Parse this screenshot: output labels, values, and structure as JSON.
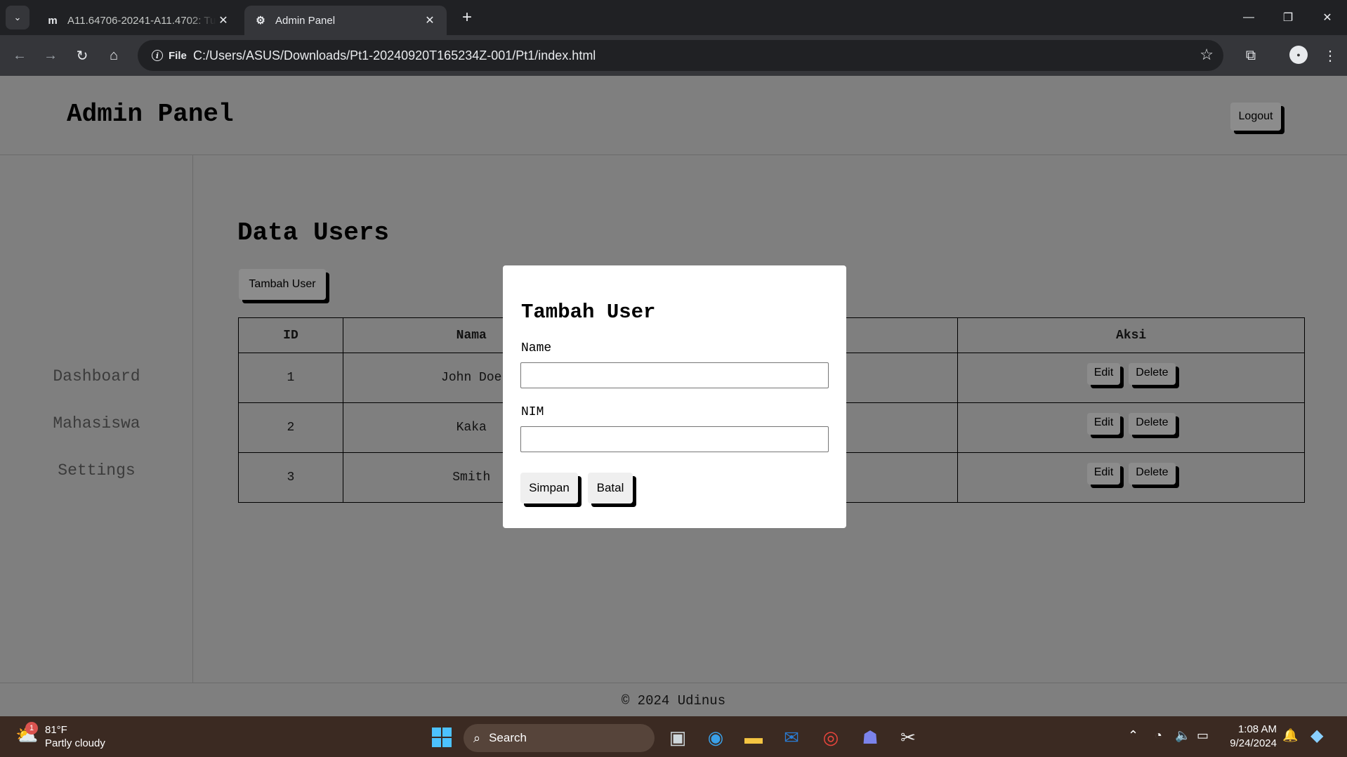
{
  "browser": {
    "tabs": [
      {
        "label": "A11.64706-20241-A11.4702: Tu",
        "favicon": "m",
        "active": false
      },
      {
        "label": "Admin Panel",
        "favicon": "gear-link-icon",
        "active": true
      }
    ],
    "site_chip": "File",
    "url": "C:/Users/ASUS/Downloads/Pt1-20240920T165234Z-001/Pt1/index.html"
  },
  "header": {
    "brand": "Admin Panel",
    "logout_label": "Logout"
  },
  "sidebar": {
    "items": [
      {
        "label": "Dashboard"
      },
      {
        "label": "Mahasiswa"
      },
      {
        "label": "Settings"
      }
    ]
  },
  "main": {
    "title": "Data Users",
    "add_label": "Tambah User",
    "table": {
      "headers": [
        "ID",
        "Nama",
        "Aksi"
      ],
      "rows": [
        {
          "id": "1",
          "nama": "John Doe"
        },
        {
          "id": "2",
          "nama": "Kaka"
        },
        {
          "id": "3",
          "nama": "Smith"
        }
      ],
      "edit_label": "Edit",
      "delete_label": "Delete"
    }
  },
  "footer": {
    "text": "© 2024 Udinus"
  },
  "modal": {
    "title": "Tambah User",
    "name_label": "Name",
    "name_value": "",
    "nim_label": "NIM",
    "nim_value": "",
    "save_label": "Simpan",
    "cancel_label": "Batal"
  },
  "taskbar": {
    "weather_temp": "81°F",
    "weather_desc": "Partly cloudy",
    "weather_badge": "1",
    "search_label": "Search",
    "time": "1:08 AM",
    "date": "9/24/2024"
  },
  "colors": {
    "page_overlay": "#7f7f7f",
    "modal_bg": "#ffffff",
    "tab_bar": "#202124",
    "toolbar": "#35363a",
    "taskbar": "#3b2a22"
  }
}
